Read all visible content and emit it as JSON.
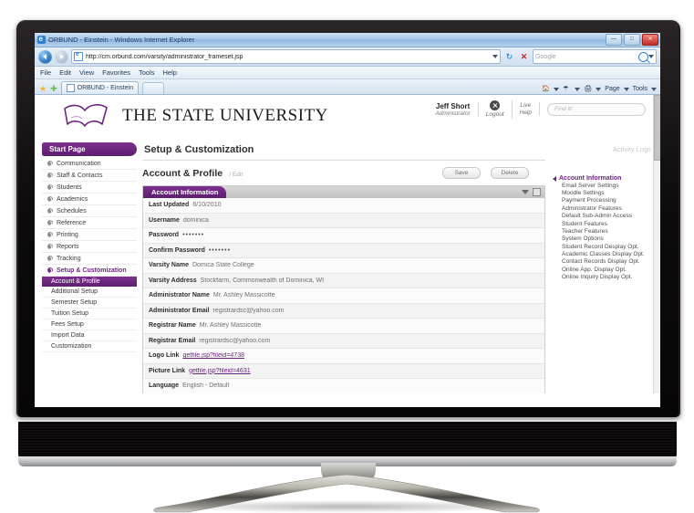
{
  "browser": {
    "window_title": "ORBUND - Einstein - Windows Internet Explorer",
    "url": "http://cm.orbund.com/varsity/administrator_frameset.jsp",
    "menu": [
      "File",
      "Edit",
      "View",
      "Favorites",
      "Tools",
      "Help"
    ],
    "tab_label": "ORBUND - Einstein",
    "search_placeholder": "Google",
    "command_bar": [
      "Page",
      "Tools"
    ],
    "window_buttons": [
      "minimize",
      "maximize",
      "close"
    ]
  },
  "header": {
    "university": "THE STATE UNIVERSITY",
    "user_name": "Jeff Short",
    "user_role": "Administrator",
    "logout_label": "Logout",
    "live_help_label": "Live\nHelp",
    "live_help_line1": "Live",
    "live_help_line2": "Help",
    "find_placeholder": "Find it!"
  },
  "sidebar": {
    "start_page": "Start Page",
    "items": [
      {
        "label": "Communication",
        "active": false
      },
      {
        "label": "Staff & Contacts",
        "active": false
      },
      {
        "label": "Students",
        "active": false
      },
      {
        "label": "Academics",
        "active": false
      },
      {
        "label": "Schedules",
        "active": false
      },
      {
        "label": "Reference",
        "active": false
      },
      {
        "label": "Printing",
        "active": false
      },
      {
        "label": "Reports",
        "active": false
      },
      {
        "label": "Tracking",
        "active": false
      },
      {
        "label": "Setup & Customization",
        "active": true
      }
    ],
    "sub_items": [
      {
        "label": "Account & Profile",
        "selected": true
      },
      {
        "label": "Additional Setup",
        "selected": false
      },
      {
        "label": "Semester Setup",
        "selected": false
      },
      {
        "label": "Tuition Setup",
        "selected": false
      },
      {
        "label": "Fees Setup",
        "selected": false
      },
      {
        "label": "Import Data",
        "selected": false
      },
      {
        "label": "Customization",
        "selected": false
      }
    ]
  },
  "main": {
    "section_title": "Setup & Customization",
    "sub_title": "Account & Profile",
    "sub_edit": "/ Edit",
    "save_label": "Save",
    "delete_label": "Delete",
    "panel_title": "Account Information",
    "rows": [
      {
        "label": "Last Updated",
        "value": "6/10/2010",
        "type": "text"
      },
      {
        "label": "Username",
        "value": "dominica",
        "type": "text"
      },
      {
        "label": "Password",
        "value": "•••••••",
        "type": "dots"
      },
      {
        "label": "Confirm Password",
        "value": "•••••••",
        "type": "dots"
      },
      {
        "label": "Varsity Name",
        "value": "Domica State College",
        "type": "text"
      },
      {
        "label": "Varsity Address",
        "value": "Stockfarm, Commonwealth of Dominica, WI",
        "type": "text"
      },
      {
        "label": "Administrator Name",
        "value": "Mr. Ashley Massicotte",
        "type": "text"
      },
      {
        "label": "Administrator Email",
        "value": "registrardsc@yahoo.com",
        "type": "text"
      },
      {
        "label": "Registrar Name",
        "value": "Mr. Ashley Massicotte",
        "type": "text"
      },
      {
        "label": "Registrar Email",
        "value": "registrardsc@yahoo.com",
        "type": "text"
      },
      {
        "label": "Logo Link",
        "value": "getfile.jsp?fileid=4738",
        "type": "link"
      },
      {
        "label": "Picture Link",
        "value": "getfile.jsp?fileid=4631",
        "type": "link"
      },
      {
        "label": "Language",
        "value": "English - Default",
        "type": "text"
      }
    ]
  },
  "rightbar": {
    "activity_logs": "Activity Logs",
    "heading": "Account Information",
    "links": [
      "Email Server Settings",
      "Moodle Settings",
      "Payment Processing",
      "Administrator Features",
      "Default Sub-Admin Access",
      "Student Features",
      "Teacher Features",
      "System Options",
      "Student Record Desplay Opt.",
      "Academic Classes Display Opt.",
      "Contact Records Display Opt.",
      "Online App. Display Opt.",
      "Online Inquiry Display Opt."
    ]
  },
  "colors": {
    "brand_purple": "#6d2580",
    "panel_header": "#7c2f8f",
    "link": "#6d2580"
  }
}
